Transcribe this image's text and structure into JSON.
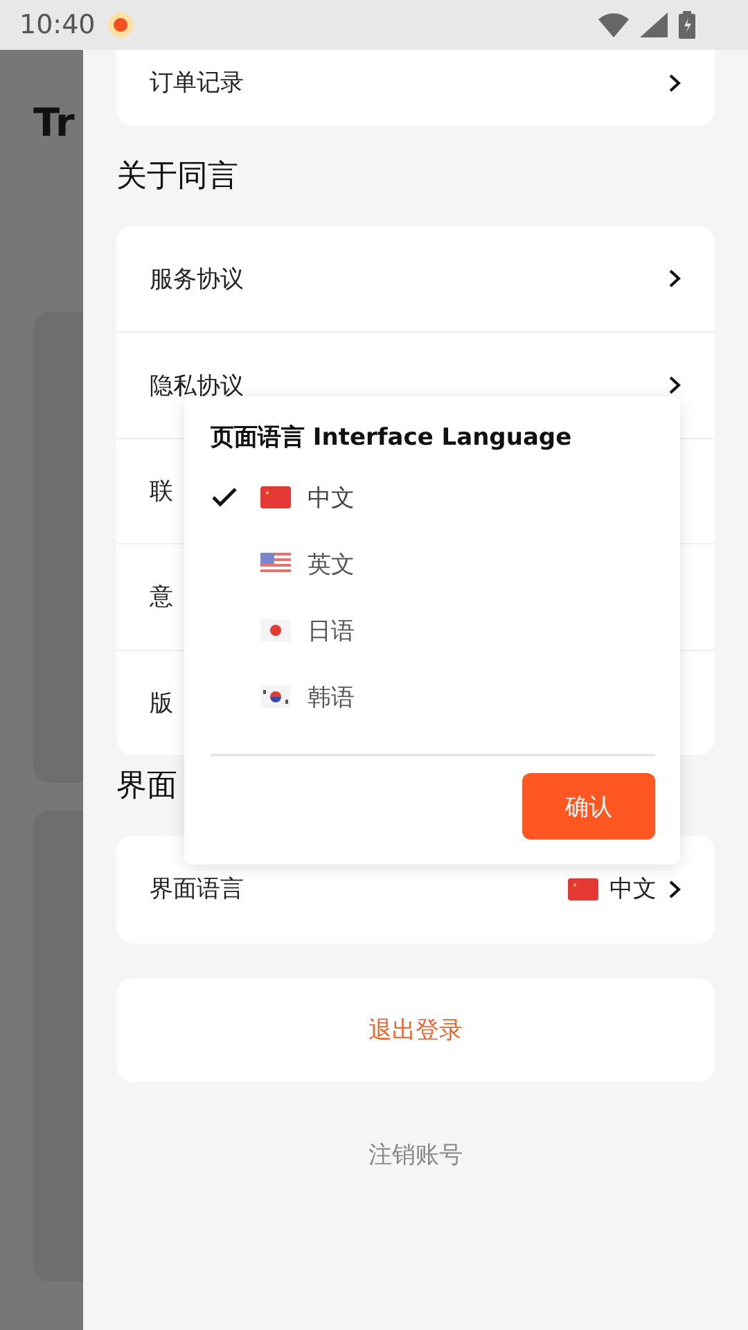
{
  "status_bar": {
    "time": "10:40"
  },
  "backdrop": {
    "title": "Tr"
  },
  "drawer": {
    "top_card": {
      "label": "订单记录"
    },
    "sections": [
      {
        "title": "关于同言",
        "rows": [
          {
            "label": "服务协议",
            "arrow": true
          },
          {
            "label": "隐私协议",
            "arrow": true
          },
          {
            "label": "联",
            "arrow": false
          },
          {
            "label": "意",
            "arrow": false
          },
          {
            "label": "版",
            "arrow": false
          }
        ]
      },
      {
        "title": "界面",
        "rows": [
          {
            "label": "界面语言",
            "arrow": true,
            "value": "中文"
          }
        ]
      }
    ],
    "logout": "退出登录",
    "delete_account": "注销账号"
  },
  "dialog": {
    "title": "页面语言 Interface Language",
    "options": [
      {
        "label": "中文",
        "kind": "cn",
        "selected": true
      },
      {
        "label": "英文",
        "kind": "us",
        "selected": false
      },
      {
        "label": "日语",
        "kind": "jp",
        "selected": false
      },
      {
        "label": "韩语",
        "kind": "kr",
        "selected": false
      }
    ],
    "confirm": "确认"
  }
}
